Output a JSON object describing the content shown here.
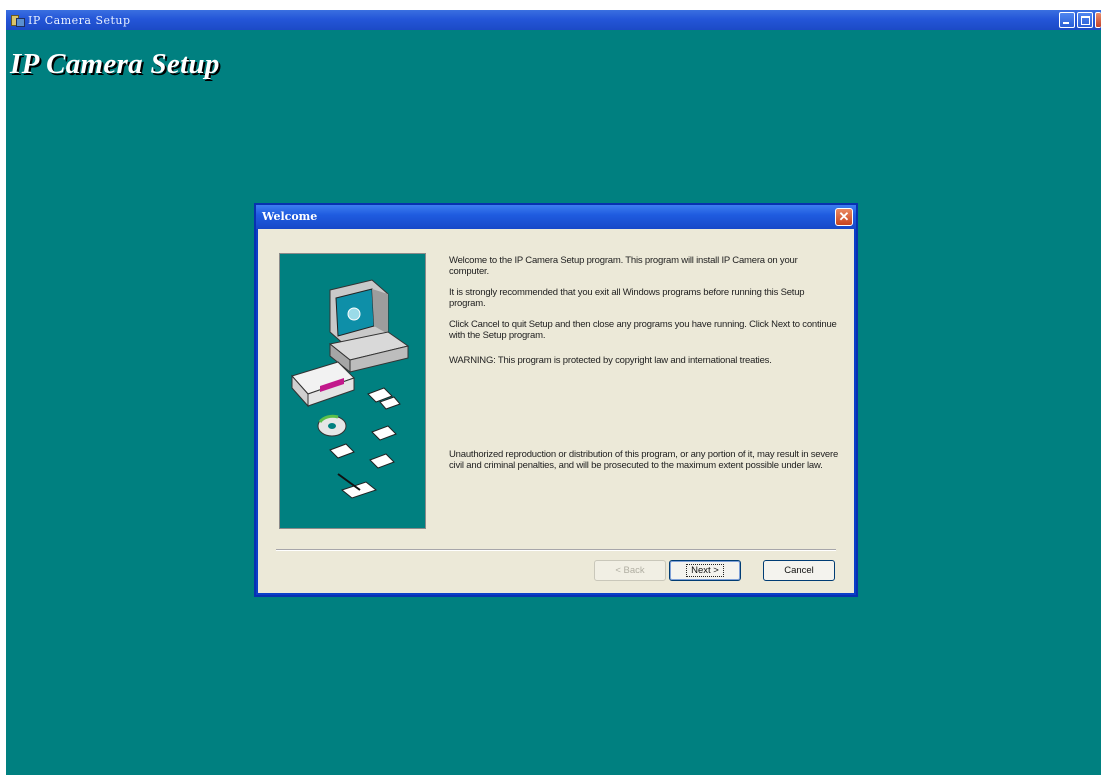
{
  "window": {
    "title": "IP Camera Setup",
    "heading": "IP Camera Setup"
  },
  "dialog": {
    "title": "Welcome",
    "close_glyph": "✕",
    "paragraphs": [
      "Welcome to the IP Camera Setup program. This program will install IP Camera on your computer.",
      "It is strongly recommended that you exit all Windows programs before running this Setup program.",
      "Click Cancel to quit Setup and then close any programs you have running. Click Next to continue with the Setup program.",
      "WARNING: This program is protected by copyright law and international treaties.",
      "Unauthorized reproduction or distribution of this program, or any portion of it, may result in severe civil and criminal penalties, and will be prosecuted to the maximum extent possible under law."
    ],
    "buttons": {
      "back": "< Back",
      "next": "Next >",
      "cancel": "Cancel"
    }
  },
  "icons": [
    "app-setup-icon",
    "minimize-icon",
    "restore-icon",
    "close-icon",
    "setup-illustration"
  ],
  "colors": {
    "desktop_teal": "#008080",
    "titlebar_blue": "#2456d8",
    "dialog_face": "#ece9d8",
    "close_red": "#c8441f"
  }
}
